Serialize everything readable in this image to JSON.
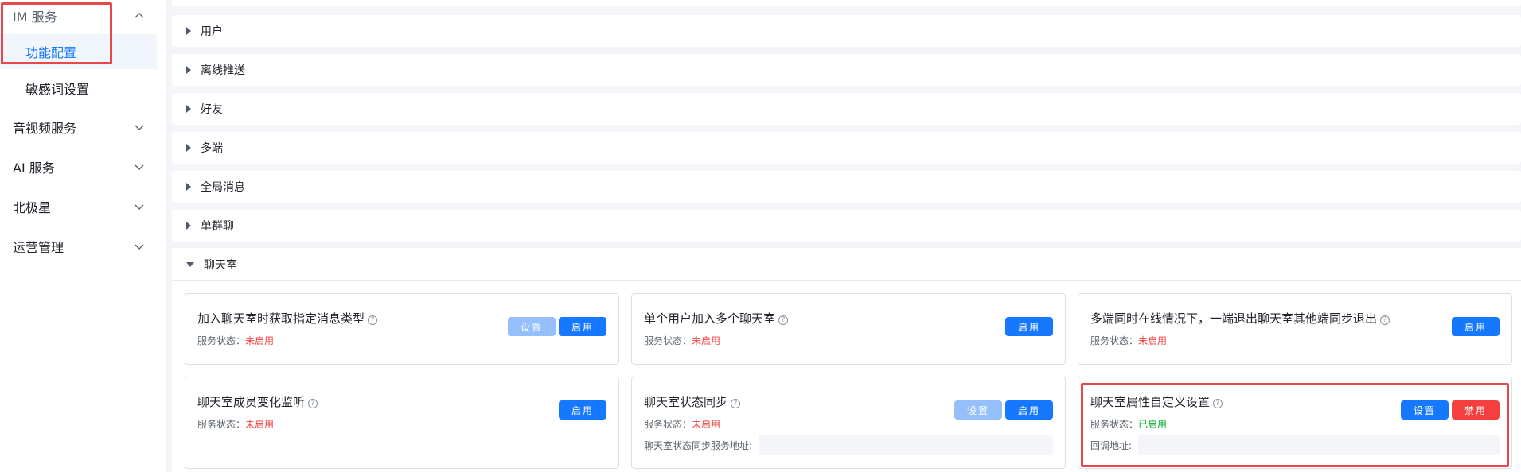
{
  "sidebar": {
    "im_service": "IM 服务",
    "function_config": "功能配置",
    "sensitive_words": "敏感词设置",
    "av_service": "音视频服务",
    "ai_service": "AI 服务",
    "polaris": "北极星",
    "operations": "运营管理"
  },
  "sections": {
    "user": "用户",
    "offline_push": "离线推送",
    "friends": "好友",
    "multi_device": "多端",
    "global_message": "全局消息",
    "single_group_chat": "单群聊",
    "chatroom": "聊天室"
  },
  "common": {
    "status_label": "服务状态：",
    "status_off": "未启用",
    "status_on": "已启用",
    "btn_settings": "设置",
    "btn_enable": "启用",
    "btn_disable": "禁用",
    "help_glyph": "?"
  },
  "cards": {
    "c1": {
      "title": "加入聊天室时获取指定消息类型"
    },
    "c2": {
      "title": "单个用户加入多个聊天室"
    },
    "c3": {
      "title": "多端同时在线情况下，一端退出聊天室其他端同步退出"
    },
    "c4": {
      "title": "聊天室成员变化监听"
    },
    "c5": {
      "title": "聊天室状态同步",
      "field_label": "聊天室状态同步服务地址:",
      "field_value": ""
    },
    "c6": {
      "title": "聊天室属性自定义设置",
      "field_label": "回调地址:",
      "field_value": ""
    }
  },
  "colors": {
    "accent": "#1677ff",
    "danger": "#f53f3f",
    "success": "#00b42a",
    "annotation": "#e8474b"
  }
}
